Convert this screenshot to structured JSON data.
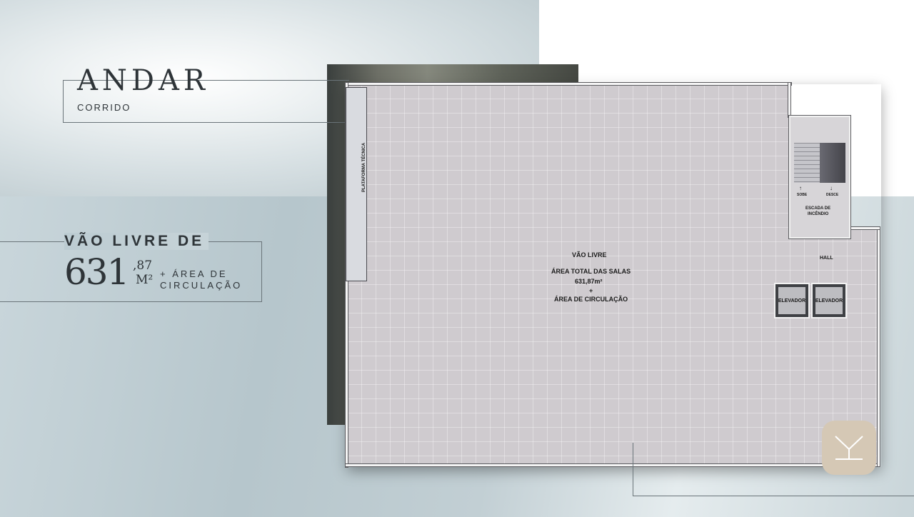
{
  "title": {
    "main": "ANDAR",
    "sub": "CORRIDO"
  },
  "area": {
    "label": "VÃO LIVRE DE",
    "number": "631",
    "decimal": ",87",
    "unit": "M²",
    "extra_line1": "+ ÁREA DE",
    "extra_line2": "CIRCULAÇÃO"
  },
  "plan": {
    "platform_label": "PLATAFORMA TÉCNICA",
    "main_title": "VÃO LIVRE",
    "main_area_label": "ÁREA TOTAL DAS SALAS",
    "main_area_value": "631,87m²",
    "plus": "+",
    "circulation": "ÁREA DE CIRCULAÇÃO",
    "stair_up": "SOBE",
    "stair_down": "DESCE",
    "stair_label_1": "ESCADA DE",
    "stair_label_2": "INCÊNDIO",
    "hall": "HALL",
    "elevator_1": "ELEVADOR",
    "elevator_2": "ELEVADOR"
  },
  "icons": {
    "up_arrow": "↑",
    "down_arrow": "↓",
    "logo": "brand-logo-icon"
  }
}
